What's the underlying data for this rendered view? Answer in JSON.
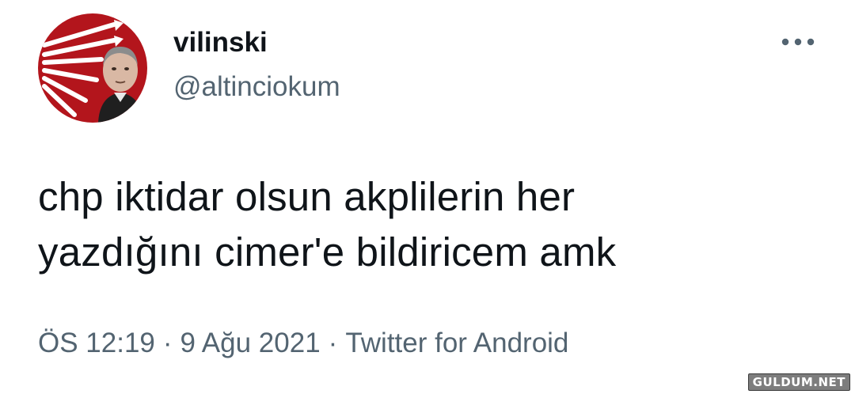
{
  "user": {
    "display_name": "vilinski",
    "handle": "@altinciokum"
  },
  "avatar": {
    "icon": "chp-six-arrows-logo-with-person",
    "background_color": "#b3151c"
  },
  "menu": {
    "icon": "more-horizontal-icon"
  },
  "tweet": {
    "text": "chp iktidar olsun akplilerin her\nyazdığını cimer'e bildiricem amk"
  },
  "meta": {
    "time": "ÖS 12:19",
    "separator": "·",
    "date": "9 Ağu 2021",
    "source": "Twitter for Android"
  },
  "watermark": {
    "text": "GULDUM.NET"
  },
  "colors": {
    "text_primary": "#0f1419",
    "text_secondary": "#536471",
    "avatar_red": "#b3151c"
  }
}
